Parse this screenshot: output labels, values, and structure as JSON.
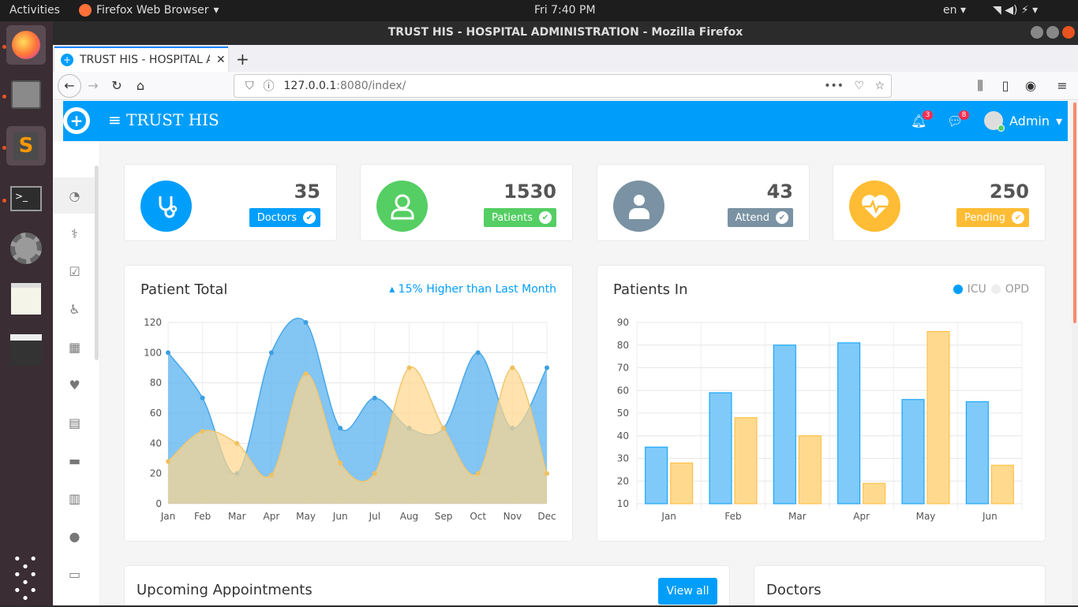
{
  "os": {
    "activities": "Activities",
    "app_name": "Firefox Web Browser",
    "clock": "Fri  7:40 PM",
    "lang": "en"
  },
  "window": {
    "title": "TRUST HIS - HOSPITAL ADMINISTRATION - Mozilla Firefox"
  },
  "browser": {
    "tab_title": "TRUST HIS - HOSPITAL AI",
    "url_host": "127.0.0.1",
    "url_rest": ":8080/index/"
  },
  "header": {
    "brand": "TRUST HIS",
    "notif_count": "3",
    "msg_count": "8",
    "user": "Admin"
  },
  "stats": [
    {
      "value": "35",
      "label": "Doctors",
      "color": "#009efb"
    },
    {
      "value": "1530",
      "label": "Patients",
      "color": "#55ce63"
    },
    {
      "value": "43",
      "label": "Attend",
      "color": "#7a92a3"
    },
    {
      "value": "250",
      "label": "Pending",
      "color": "#ffbc34"
    }
  ],
  "patient_total": {
    "title": "Patient Total",
    "trend": "15% Higher than Last Month"
  },
  "patients_in": {
    "title": "Patients In",
    "legend": [
      "ICU",
      "OPD"
    ]
  },
  "chart_data": [
    {
      "type": "area",
      "x": [
        "Jan",
        "Feb",
        "Mar",
        "Apr",
        "May",
        "Jun",
        "Jul",
        "Aug",
        "Sep",
        "Oct",
        "Nov",
        "Dec"
      ],
      "ylim": [
        0,
        120
      ],
      "yticks": [
        0,
        20,
        40,
        60,
        80,
        100,
        120
      ],
      "series": [
        {
          "values": [
            100,
            70,
            20,
            100,
            120,
            50,
            70,
            50,
            50,
            100,
            50,
            90
          ],
          "color": "#5ab1ef"
        },
        {
          "values": [
            28,
            48,
            40,
            19,
            86,
            27,
            20,
            90,
            50,
            20,
            90,
            20
          ],
          "color": "#ffd58a"
        }
      ]
    },
    {
      "type": "bar",
      "categories": [
        "Jan",
        "Feb",
        "Mar",
        "Apr",
        "May",
        "Jun"
      ],
      "ylim": [
        10,
        90
      ],
      "yticks": [
        10,
        20,
        30,
        40,
        50,
        60,
        70,
        80,
        90
      ],
      "series": [
        {
          "name": "ICU",
          "values": [
            35,
            59,
            80,
            81,
            56,
            55
          ],
          "color": "#009efb"
        },
        {
          "name": "OPD",
          "values": [
            28,
            48,
            40,
            19,
            86,
            27
          ],
          "color": "#ffbc34"
        }
      ]
    }
  ],
  "appointments": {
    "title": "Upcoming Appointments",
    "view_all": "View all"
  },
  "doctors": {
    "title": "Doctors"
  }
}
